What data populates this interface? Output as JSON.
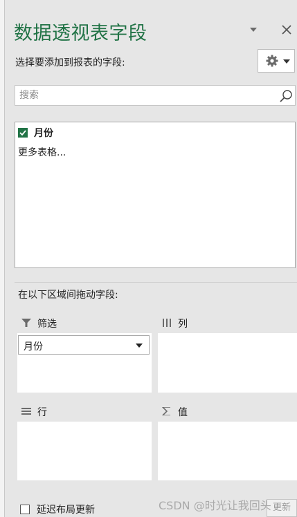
{
  "pane": {
    "title": "数据透视表字段",
    "subtitle": "选择要添加到报表的字段:",
    "icons": {
      "options": "chevron-down-icon",
      "close": "close-icon",
      "tools": "gear-icon"
    }
  },
  "search": {
    "placeholder": "搜索",
    "value": "",
    "icon": "search-icon"
  },
  "fields": [
    {
      "label": "月份",
      "checked": true
    }
  ],
  "more_tables": "更多表格...",
  "drag_instructions": "在以下区域间拖动字段:",
  "areas": {
    "filters": {
      "label": "筛选",
      "icon": "filter-icon",
      "items": [
        "月份"
      ]
    },
    "columns": {
      "label": "列",
      "icon": "columns-icon",
      "items": []
    },
    "rows": {
      "label": "行",
      "icon": "rows-icon",
      "items": []
    },
    "values": {
      "label": "值",
      "icon": "sigma-icon",
      "items": []
    }
  },
  "defer_update": {
    "label": "延迟布局更新",
    "checked": false
  },
  "update_button": "更新",
  "watermark": "CSDN @时光让我回头",
  "colors": {
    "accent": "#217346",
    "pane_bg": "#e6e6e6"
  }
}
